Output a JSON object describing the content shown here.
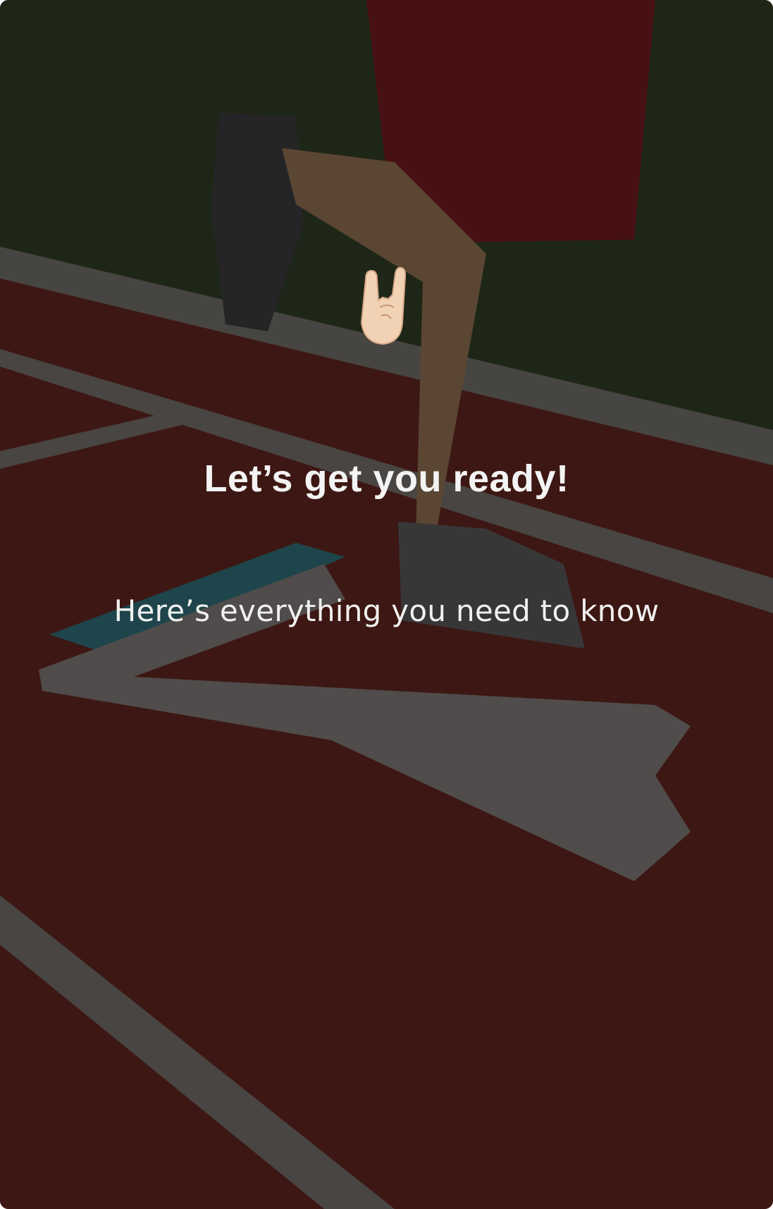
{
  "onboarding": {
    "emoji": "🤘",
    "emoji_icon": "rock-on-hand-icon",
    "title": "Let’s get you ready!",
    "subtitle": "Here’s everything you need to know"
  },
  "colors": {
    "title_text": "#f3f3f3",
    "track": "#6b2a22",
    "grass": "#2c3a22"
  }
}
